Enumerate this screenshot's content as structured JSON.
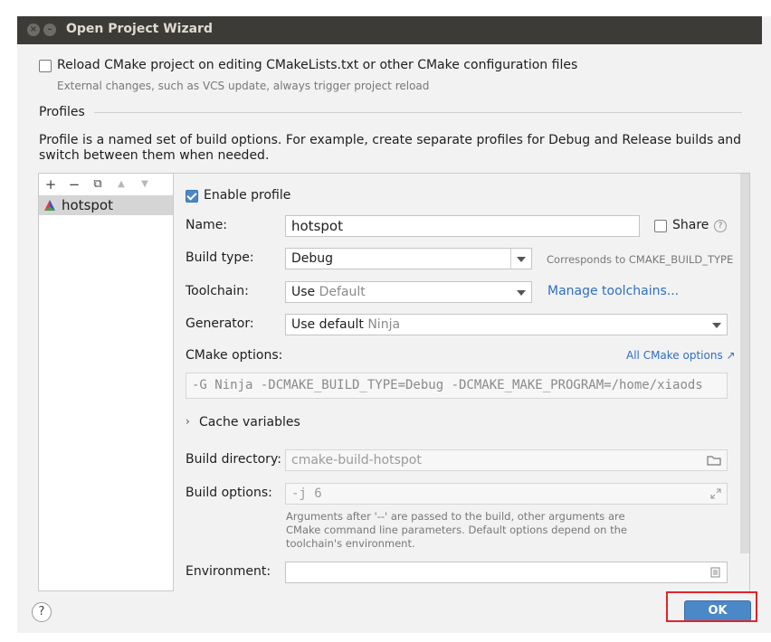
{
  "window": {
    "title": "Open Project Wizard",
    "close_glyph": "×",
    "minimize_glyph": "–"
  },
  "reload": {
    "label": "Reload CMake project on editing CMakeLists.txt or other CMake configuration files",
    "hint": "External changes, such as VCS update, always trigger project reload",
    "checked": false
  },
  "profiles": {
    "section_title": "Profiles",
    "description": "Profile is a named set of build options. For example, create separate profiles for Debug and Release builds and switch between them when needed.",
    "description_line1": "Profile is a named set of build options. For example, create separate profiles for Debug and Release builds and",
    "description_line2": "switch between them when needed.",
    "toolbar": {
      "add": "+",
      "remove": "−",
      "copy": "⧉",
      "up": "▲",
      "down": "▼"
    },
    "items": [
      {
        "label": "hotspot",
        "selected": true
      }
    ]
  },
  "form": {
    "enable_profile_label": "Enable profile",
    "enable_profile_checked": true,
    "name_label": "Name:",
    "name_value": "hotspot",
    "share_label": "Share",
    "share_checked": false,
    "build_type_label": "Build type:",
    "build_type_value": "Debug",
    "build_type_hint": "Corresponds to CMAKE_BUILD_TYPE",
    "toolchain_label": "Toolchain:",
    "toolchain_use": "Use",
    "toolchain_value": "Default",
    "manage_toolchains_link": "Manage toolchains...",
    "generator_label": "Generator:",
    "generator_use": "Use default",
    "generator_value": "Ninja",
    "cmake_options_label": "CMake options:",
    "all_cmake_options_link": "All CMake options ↗",
    "cmake_options_value": "-G Ninja -DCMAKE_BUILD_TYPE=Debug -DCMAKE_MAKE_PROGRAM=/home/xiaods",
    "cache_variables_label": "Cache variables",
    "build_directory_label": "Build directory:",
    "build_directory_placeholder": "cmake-build-hotspot",
    "build_options_label": "Build options:",
    "build_options_placeholder": "-j 6",
    "build_options_hint_line1": "Arguments after '--' are passed to the build, other arguments are",
    "build_options_hint_line2": "CMake command line parameters. Default options depend on the",
    "build_options_hint_line3": "toolchain's environment.",
    "environment_label": "Environment:"
  },
  "footer": {
    "help_label": "?",
    "ok_label": "OK"
  },
  "colors": {
    "accent": "#4a88c7",
    "link": "#2f6fc0",
    "highlight": "#e0252b",
    "titlebar": "#3c3b37"
  }
}
